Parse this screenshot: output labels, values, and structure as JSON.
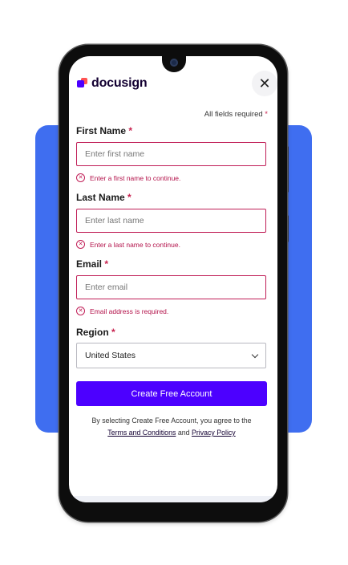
{
  "brand": {
    "name": "docusign",
    "accent_color": "#4c00ff",
    "logo_red": "#ff5252",
    "backdrop_color": "#3f6ef0",
    "error_color": "#c01e57"
  },
  "header": {
    "close_icon": "close-icon",
    "close_glyph": "✕"
  },
  "form": {
    "required_note": "All fields required",
    "required_star": "*",
    "first_name": {
      "label": "First Name",
      "placeholder": "Enter first name",
      "error": "Enter a first name to continue."
    },
    "last_name": {
      "label": "Last Name",
      "placeholder": "Enter last name",
      "error": "Enter a last name to continue."
    },
    "email": {
      "label": "Email",
      "placeholder": "Enter email",
      "error": "Email address is required."
    },
    "region": {
      "label": "Region",
      "selected": "United States"
    },
    "submit_label": "Create Free Account",
    "legal": {
      "prefix": "By selecting Create Free Account, you agree to the",
      "terms_link": "Terms and Conditions",
      "conjunction": "and",
      "privacy_link": "Privacy Policy"
    }
  }
}
